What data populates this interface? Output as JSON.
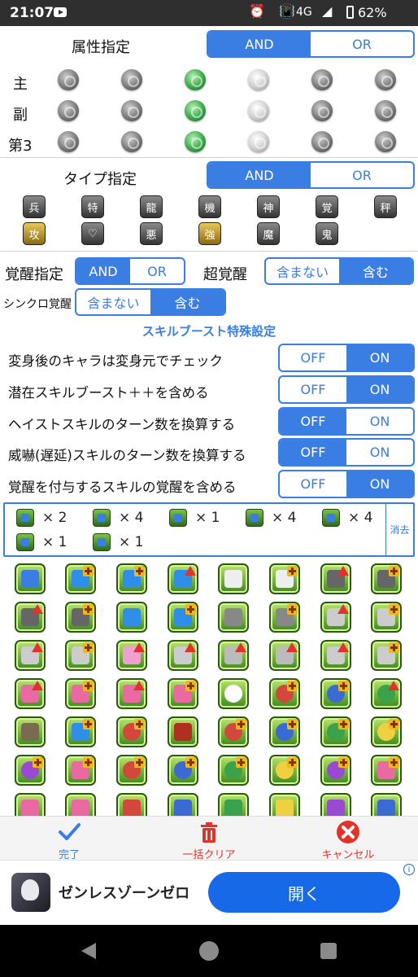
{
  "status_bar": {
    "time": "21:07",
    "network": "4G",
    "battery": "62%"
  },
  "attribute": {
    "title": "属性指定",
    "toggle": {
      "and": "AND",
      "or": "OR",
      "selected": "AND"
    },
    "rows": [
      {
        "label": "主",
        "orbs": [
          "fire",
          "water",
          "wood",
          "light",
          "dark",
          "none"
        ]
      },
      {
        "label": "副",
        "orbs": [
          "fire",
          "water",
          "wood",
          "light",
          "dark",
          "none"
        ]
      },
      {
        "label": "第3",
        "orbs": [
          "fire",
          "water",
          "wood",
          "light",
          "dark",
          "none"
        ]
      }
    ]
  },
  "type": {
    "title": "タイプ指定",
    "toggle": {
      "and": "AND",
      "or": "OR",
      "selected": "AND"
    },
    "icon_glyphs_row1": [
      "兵",
      "特",
      "龍",
      "機",
      "神",
      "覚",
      "秤"
    ],
    "icon_glyphs_row2": [
      "攻",
      "♡",
      "悪",
      "強",
      "魔",
      "鬼"
    ]
  },
  "awaken": {
    "title": "覚醒指定",
    "toggle": {
      "and": "AND",
      "or": "OR",
      "selected": "AND"
    }
  },
  "super_awaken": {
    "title": "超覚醒",
    "toggle": {
      "off": "含まない",
      "on": "含む",
      "selected": "含む"
    }
  },
  "sync_awaken": {
    "title": "シンクロ覚醒",
    "toggle": {
      "off": "含まない",
      "on": "含む",
      "selected": "含む"
    }
  },
  "skill_boost": {
    "title": "スキルブースト特殊設定",
    "settings": [
      {
        "label": "変身後のキャラは変身元でチェック",
        "off": "OFF",
        "on": "ON",
        "selected": "ON"
      },
      {
        "label": "潜在スキルブースト＋＋を含める",
        "off": "OFF",
        "on": "ON",
        "selected": "ON"
      },
      {
        "label": "ヘイストスキルのターン数を換算する",
        "off": "OFF",
        "on": "ON",
        "selected": "OFF"
      },
      {
        "label": "威嚇(遅延)スキルのターン数を換算する",
        "off": "OFF",
        "on": "ON",
        "selected": "OFF"
      },
      {
        "label": "覚醒を付与するスキルの覚醒を含める",
        "off": "OFF",
        "on": "ON",
        "selected": "ON"
      }
    ]
  },
  "selected": {
    "clear_label": "消去",
    "items": [
      {
        "icon": "seal-delete-icon",
        "count": "× 2"
      },
      {
        "icon": "skill-boost-plus-icon",
        "count": "× 4"
      },
      {
        "icon": "bind-resist-plus-icon",
        "count": "× 1"
      },
      {
        "icon": "combo-10-icon",
        "count": "× 4"
      },
      {
        "icon": "orb-lock-icon",
        "count": "× 4"
      },
      {
        "icon": "cup-icon",
        "count": "× 1"
      },
      {
        "icon": "sword-icon",
        "count": "× 1"
      }
    ]
  },
  "toolbar": {
    "done": "完了",
    "clear_all": "一括クリア",
    "cancel": "キャンセル"
  },
  "ad": {
    "name": "ゼンレスゾーンゼロ",
    "open": "開く",
    "info": "i"
  },
  "colors": {
    "accent": "#3a7de3",
    "red": "#e3322a",
    "ad_button": "#1769e8"
  }
}
